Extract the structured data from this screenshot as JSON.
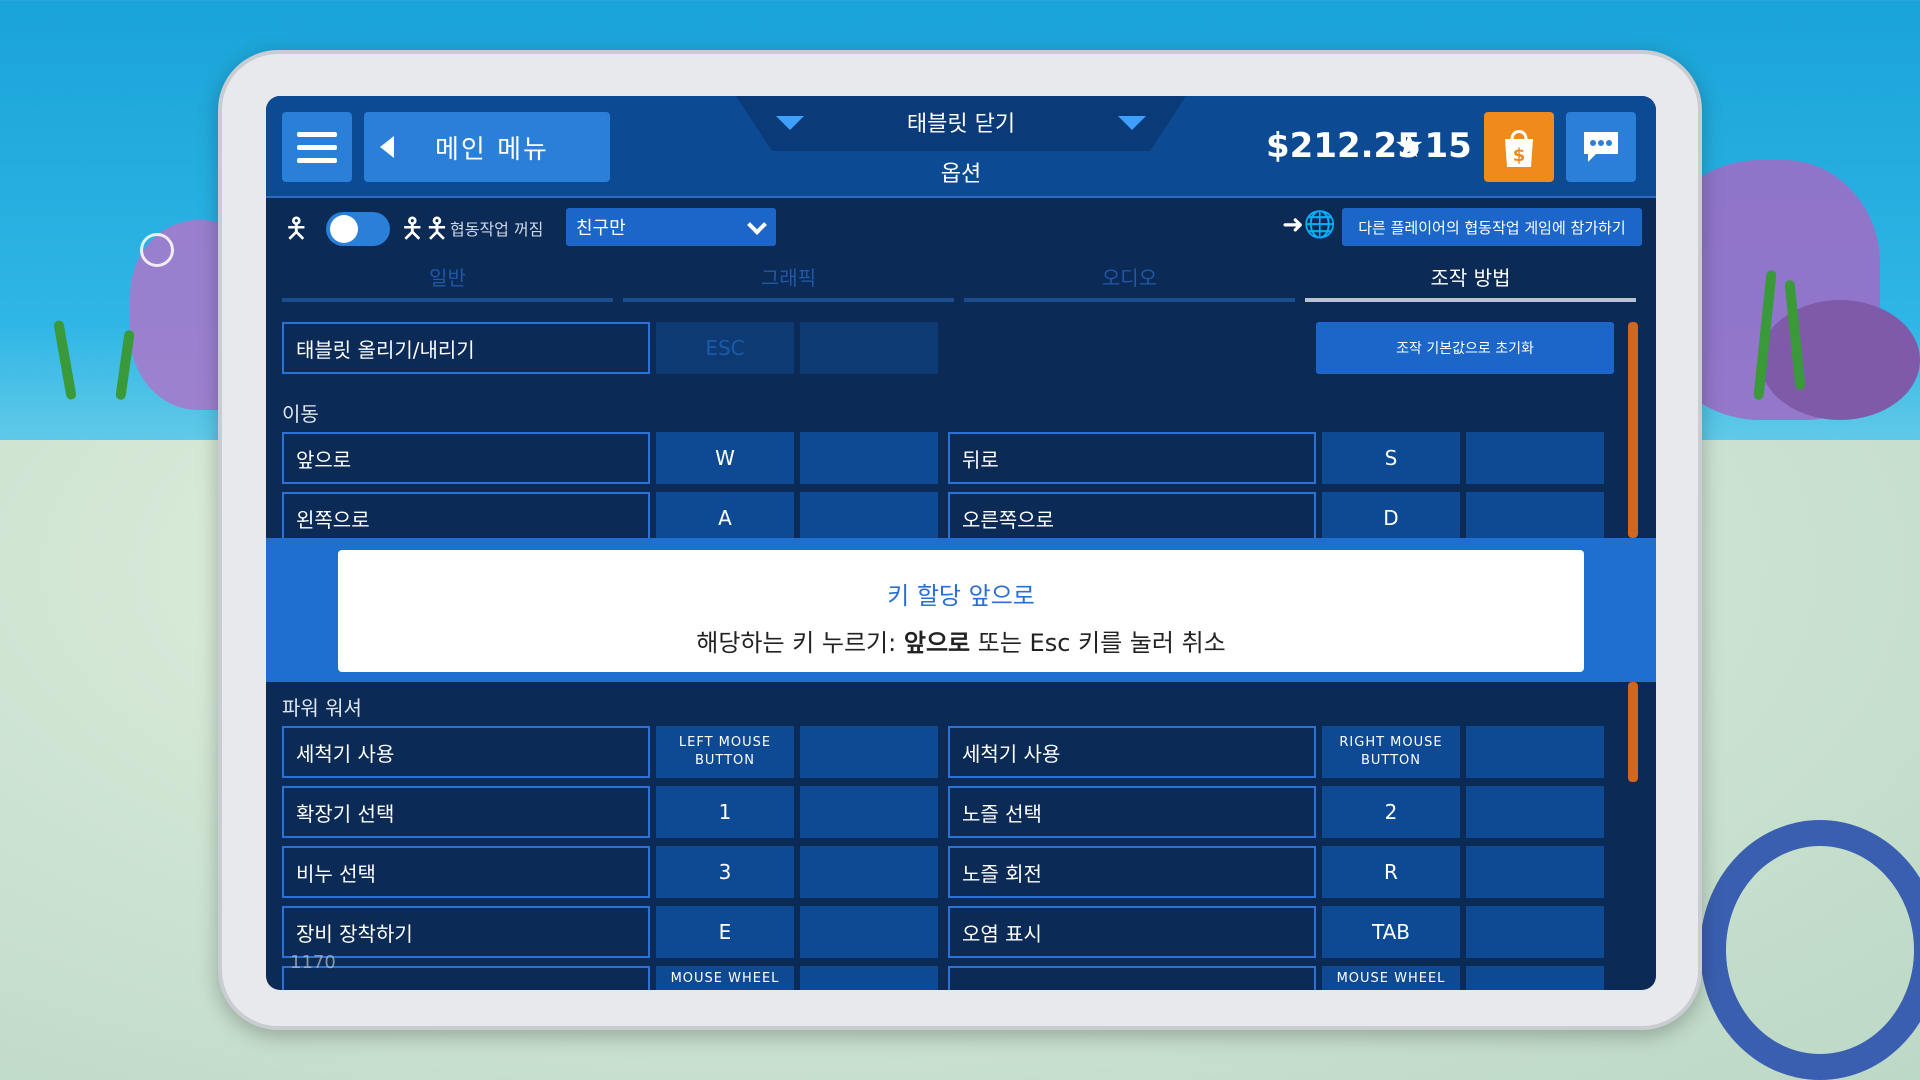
{
  "header": {
    "main_menu": "메인 메뉴",
    "tablet_close": "태블릿 닫기",
    "options": "옵션",
    "money": "$212.25",
    "stars": "★15"
  },
  "coop": {
    "label": "협동작업 꺼짐",
    "select_value": "친구만",
    "join_label": "다른 플레이어의 협동작업 게임에 참가하기"
  },
  "tabs": [
    "일반",
    "그래픽",
    "오디오",
    "조작 방법"
  ],
  "top_row": {
    "name": "태블릿 올리기/내리기",
    "key": "ESC",
    "reset": "조작 기본값으로 초기화"
  },
  "sections": {
    "movement": "이동",
    "power_washer": "파워 워셔"
  },
  "movement_rows": [
    {
      "left_name": "앞으로",
      "left_key": "W",
      "right_name": "뒤로",
      "right_key": "S"
    },
    {
      "left_name": "왼쪽으로",
      "left_key": "A",
      "right_name": "오른쪽으로",
      "right_key": "D"
    }
  ],
  "washer_rows": [
    {
      "left_name": "세척기 사용",
      "left_key": "LEFT MOUSE BUTTON",
      "right_name": "세척기 사용",
      "right_key": "RIGHT MOUSE BUTTON"
    },
    {
      "left_name": "확장기 선택",
      "left_key": "1",
      "right_name": "노즐 선택",
      "right_key": "2"
    },
    {
      "left_name": "비누 선택",
      "left_key": "3",
      "right_name": "노즐 회전",
      "right_key": "R"
    },
    {
      "left_name": "장비 장착하기",
      "left_key": "E",
      "right_name": "오염 표시",
      "right_key": "TAB"
    },
    {
      "left_name": "",
      "left_key": "MOUSE WHEEL",
      "right_name": "",
      "right_key": "MOUSE WHEEL"
    }
  ],
  "modal": {
    "title": "키 할당 앞으로",
    "msg_prefix": "해당하는 키 누르기: ",
    "msg_action": "앞으로",
    "msg_suffix": " 또는 Esc 키를 눌러 취소"
  },
  "fps": "1170",
  "colors": {
    "panel": "#0b2a55",
    "header": "#0c4a94",
    "button": "#2a7fd8",
    "shop": "#f08a1c",
    "accent_border": "#2a73d4",
    "modal_band": "#1f6fd0"
  },
  "icons": [
    "hamburger-icon",
    "back-arrow-icon",
    "chevron-down-icon",
    "shop-bag-icon",
    "chat-icon",
    "single-player-icon",
    "coop-players-icon",
    "join-globe-icon"
  ]
}
